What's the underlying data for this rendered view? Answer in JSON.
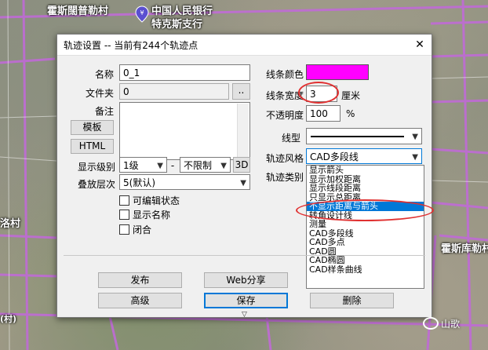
{
  "map": {
    "labels": [
      "霍斯闊普勒村",
      "中国人民银行",
      "特克斯支行",
      "霍斯库勒村",
      "洛村",
      "(村)"
    ]
  },
  "dialog": {
    "title": "轨迹设置 -- 当前有244个轨迹点",
    "close": "✕",
    "name_label": "名称",
    "name_value": "0_1",
    "folder_label": "文件夹",
    "folder_value": "0",
    "folder_browse": "..",
    "note_label": "备注",
    "template_button": "模板",
    "html_button": "HTML",
    "display_level_label": "显示级别",
    "display_level_value": "1级",
    "level_separator": "-",
    "display_level_max": "不限制",
    "btn_3d": "3D",
    "layer_label": "叠放层次",
    "layer_value": "5(默认)",
    "checkbox_editable": "可编辑状态",
    "checkbox_show_name": "显示名称",
    "checkbox_closed": "闭合",
    "line_color_label": "线条颜色",
    "line_color": "#ff00ff",
    "line_width_label": "线条宽度",
    "line_width_value": "3",
    "line_width_unit": "厘米",
    "opacity_label": "不透明度",
    "opacity_value": "100",
    "opacity_unit": "%",
    "line_type_label": "线型",
    "track_style_label": "轨迹风格",
    "track_style_value": "CAD多段线",
    "track_type_label": "轨迹类别",
    "publish_button": "发布",
    "web_share_button": "Web分享",
    "advanced_button": "高级",
    "save_button": "保存",
    "delete_button": "删除"
  },
  "dropdown": {
    "items": [
      "显示箭头",
      "显示加权距离",
      "显示线段距离",
      "只显示总距离",
      "不显示距离与箭头",
      "转角设计线",
      "测量",
      "CAD多段线",
      "CAD多点",
      "CAD圆",
      "CAD椭圆",
      "CAD样条曲线"
    ],
    "highlighted_index": 4
  },
  "watermark": {
    "text": "山歌"
  },
  "colors": {
    "highlight": "#0078d7",
    "annotation_red": "#e03030",
    "road_purple": "#c06bd6"
  }
}
